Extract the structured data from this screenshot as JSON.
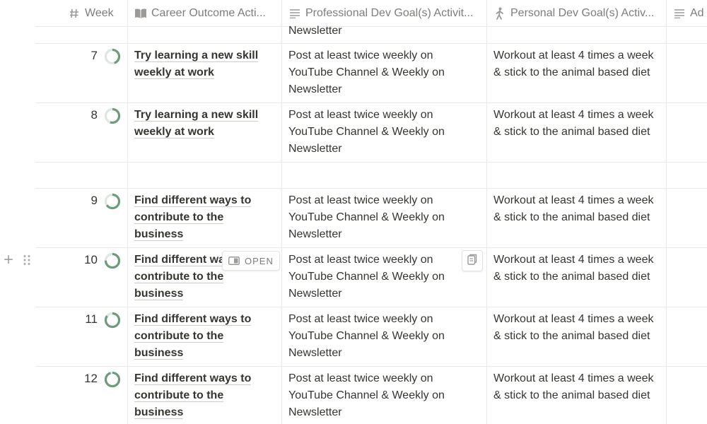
{
  "headers": {
    "week": {
      "label": "Week",
      "icon": "hash-icon"
    },
    "career": {
      "label": "Career Outcome Acti...",
      "icon": "book-icon"
    },
    "professional": {
      "label": "Professional Dev Goal(s) Activit...",
      "icon": "text-lines-icon"
    },
    "personal": {
      "label": "Personal Dev Goal(s) Activ...",
      "icon": "person-walk-icon"
    },
    "next": {
      "label": "Ad",
      "icon": "text-lines-icon"
    }
  },
  "top_partial": {
    "professional": "Newsletter"
  },
  "rows": [
    {
      "week": "7",
      "progress": 0.45,
      "career_l1": "Try learning a new skill",
      "career_l2": "weekly at work",
      "career_l3": "",
      "prof_l1": "Post at least twice weekly on",
      "prof_l2": "YouTube Channel & Weekly on",
      "prof_l3": "Newsletter",
      "pers_l1": "Workout at least 4 times a week",
      "pers_l2": "& stick to the animal based diet"
    },
    {
      "week": "8",
      "progress": 0.55,
      "career_l1": "Try learning a new skill",
      "career_l2": "weekly at work",
      "career_l3": "",
      "prof_l1": "Post at least twice weekly on",
      "prof_l2": "YouTube Channel & Weekly on",
      "prof_l3": "Newsletter",
      "pers_l1": "Workout at least 4 times a week",
      "pers_l2": "& stick to the animal based diet"
    },
    {
      "week": "9",
      "progress": 0.65,
      "career_l1": "Find different ways to",
      "career_l2": "contribute to the",
      "career_l3": "business",
      "prof_l1": "Post at least twice weekly on",
      "prof_l2": "YouTube Channel & Weekly on",
      "prof_l3": "Newsletter",
      "pers_l1": "Workout at least 4 times a week",
      "pers_l2": "& stick to the animal based diet"
    },
    {
      "week": "10",
      "progress": 0.75,
      "career_l1": "Find different wa",
      "career_l2": "contribute to the",
      "career_l3": "business",
      "prof_l1": "Post at least twice weekly on",
      "prof_l2": "YouTube Channel & Weekly on",
      "prof_l3": "Newsletter",
      "pers_l1": "Workout at least 4 times a week",
      "pers_l2": "& stick to the animal based diet"
    },
    {
      "week": "11",
      "progress": 0.85,
      "career_l1": "Find different ways to",
      "career_l2": "contribute to the",
      "career_l3": "business",
      "prof_l1": "Post at least twice weekly on",
      "prof_l2": "YouTube Channel & Weekly on",
      "prof_l3": "Newsletter",
      "pers_l1": "Workout at least 4 times a week",
      "pers_l2": "& stick to the animal based diet"
    },
    {
      "week": "12",
      "progress": 0.95,
      "career_l1": "Find different ways to",
      "career_l2": "contribute to the",
      "career_l3": "business",
      "prof_l1": "Post at least twice weekly on",
      "prof_l2": "YouTube Channel & Weekly on",
      "prof_l3": "Newsletter",
      "pers_l1": "Workout at least 4 times a week",
      "pers_l2": "& stick to the animal based diet"
    }
  ],
  "hover": {
    "open_label": "OPEN",
    "open_icon": "open-panel-icon",
    "copy_icon": "copy-icon",
    "add_icon": "plus-icon",
    "drag_icon": "drag-handle-icon"
  },
  "colors": {
    "progress": "#6c9b7d",
    "progress_track": "#dde8e0"
  }
}
